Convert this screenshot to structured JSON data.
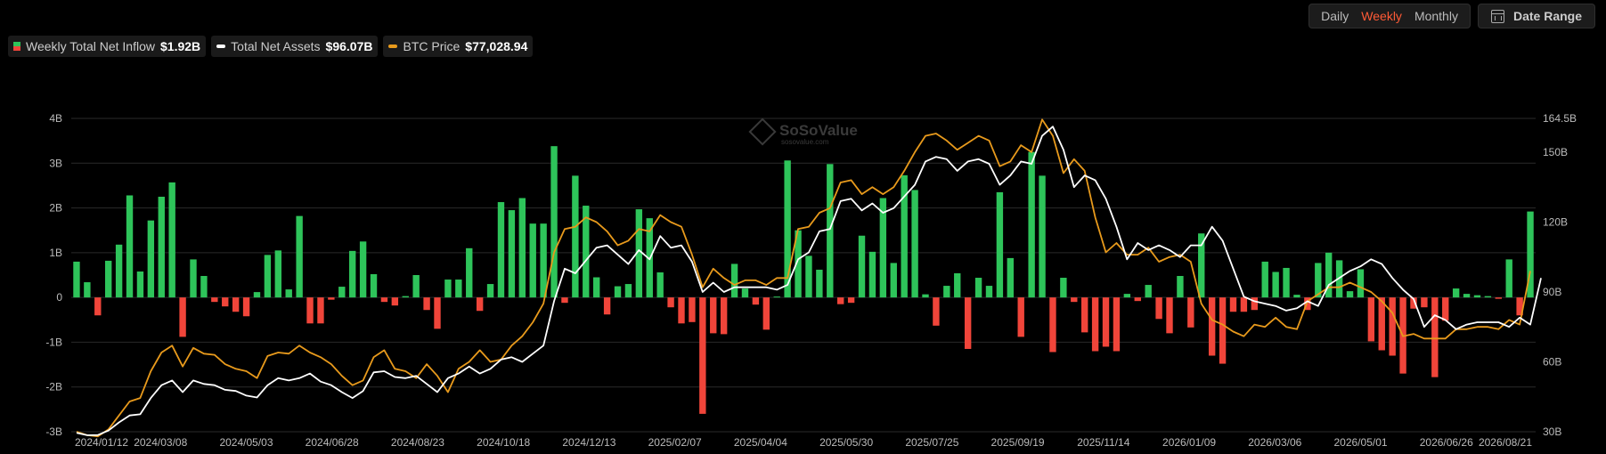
{
  "controls": {
    "daily": "Daily",
    "weekly": "Weekly",
    "monthly": "Monthly",
    "date_range": "Date Range"
  },
  "legend": {
    "inflow_label": "Weekly Total Net Inflow",
    "inflow_value": "$1.92B",
    "assets_label": "Total Net Assets",
    "assets_value": "$96.07B",
    "btc_label": "BTC Price",
    "btc_value": "$77,028.94"
  },
  "watermark": {
    "brand": "SoSoValue",
    "site": "sosovalue.com"
  },
  "colors": {
    "positive": "#2ec45a",
    "negative": "#f0453a",
    "assets_line": "#ffffff",
    "btc_line": "#e89a1c",
    "grid": "#2a2a2a"
  },
  "chart_data": {
    "type": "bar",
    "title": "",
    "xlabel": "",
    "ylabel": "",
    "ylim": [
      -3,
      4
    ],
    "y_ticks": [
      "-3B",
      "-2B",
      "-1B",
      "0",
      "1B",
      "2B",
      "3B",
      "4B"
    ],
    "y2lim": [
      30,
      164.5
    ],
    "y2_ticks": [
      "30B",
      "60B",
      "90B",
      "120B",
      "150B",
      "164.5B"
    ],
    "x_ticks": [
      "2024/01/12",
      "2024/03/08",
      "2024/05/03",
      "2024/06/28",
      "2024/08/23",
      "2024/10/18",
      "2024/12/13",
      "2025/02/07",
      "2025/04/04",
      "2025/05/30",
      "2025/07/25",
      "2025/09/19",
      "2025/11/14",
      "2026/01/09",
      "2026/03/06",
      "2026/05/01",
      "2026/06/26",
      "2026/08/21"
    ],
    "grid": true,
    "series": [
      {
        "name": "Weekly Total Net Inflow",
        "kind": "bar",
        "values": [
          0.8,
          0.34,
          -0.4,
          0.82,
          1.18,
          2.28,
          0.58,
          1.72,
          2.25,
          2.57,
          -0.88,
          0.85,
          0.48,
          -0.1,
          -0.2,
          -0.32,
          -0.42,
          0.12,
          0.95,
          1.05,
          0.18,
          1.82,
          -0.58,
          -0.58,
          -0.05,
          0.24,
          1.04,
          1.25,
          0.52,
          -0.1,
          -0.18,
          0.03,
          0.5,
          -0.28,
          -0.7,
          0.4,
          0.4,
          1.1,
          -0.3,
          0.3,
          2.13,
          1.95,
          2.22,
          1.65,
          1.65,
          3.38,
          -0.12,
          2.72,
          2.05,
          0.45,
          -0.38,
          0.25,
          0.3,
          1.97,
          1.77,
          0.56,
          -0.22,
          -0.58,
          -0.55,
          -2.6,
          -0.8,
          -0.82,
          0.75,
          0.2,
          -0.16,
          -0.72,
          0.02,
          3.06,
          1.5,
          0.93,
          0.62,
          2.98,
          -0.15,
          -0.12,
          1.38,
          1.02,
          2.22,
          0.77,
          2.73,
          2.4,
          0.07,
          -0.63,
          0.26,
          0.54,
          -1.15,
          0.44,
          0.26,
          2.35,
          0.88,
          -0.88,
          3.25,
          2.72,
          -1.22,
          0.44,
          -0.1,
          -0.78,
          -1.2,
          -1.1,
          -1.2,
          0.08,
          -0.08,
          0.28,
          -0.48,
          -0.8,
          0.48,
          -0.67,
          1.43,
          -1.3,
          -1.48,
          -0.32,
          -0.32,
          -0.28,
          0.8,
          0.57,
          0.66,
          0.06,
          -0.28,
          0.77,
          1.0,
          0.83,
          0.14,
          0.63,
          -0.98,
          -1.18,
          -1.3,
          -1.7,
          -0.25,
          -0.22,
          -1.78,
          -0.52,
          0.2,
          0.08,
          0.05,
          0.03,
          -0.03,
          0.85,
          -0.4,
          1.92
        ]
      },
      {
        "name": "Total Net Assets",
        "kind": "line",
        "values": [
          29.5,
          28.5,
          28.6,
          30.5,
          34,
          37,
          37.5,
          44.5,
          50,
          52,
          47,
          52,
          50.5,
          50,
          48,
          47.5,
          45.5,
          44.7,
          50,
          53,
          52,
          53,
          55,
          51.5,
          50,
          47,
          44.5,
          47.5,
          55.5,
          56,
          53.5,
          53,
          54,
          50.5,
          47,
          53,
          55,
          58,
          55,
          57,
          61,
          62,
          60,
          63.5,
          67,
          86,
          100,
          98,
          103.5,
          109,
          110,
          106,
          102,
          108,
          104,
          114,
          109,
          110,
          103,
          90,
          94,
          90,
          92,
          92,
          92,
          92,
          91,
          93,
          104,
          107,
          116,
          117,
          129,
          130,
          125,
          128,
          124,
          126,
          131,
          136,
          146,
          148,
          147,
          142,
          146,
          147,
          145,
          136,
          140,
          146,
          145,
          157,
          161,
          151,
          135,
          140,
          138,
          130,
          118,
          104,
          111,
          108,
          110,
          108,
          105,
          110,
          110,
          118,
          112,
          100,
          88,
          86,
          85,
          84,
          82,
          83,
          86,
          84,
          93,
          96,
          99,
          101,
          104,
          102,
          96,
          91,
          87,
          75,
          80,
          78,
          74,
          76,
          77,
          77,
          77,
          75,
          79,
          76,
          96
        ]
      },
      {
        "name": "BTC Price",
        "kind": "line",
        "values": [
          30,
          28.5,
          28,
          31,
          37,
          43,
          44.5,
          56,
          64,
          67,
          58,
          66,
          63.5,
          63,
          59,
          57,
          56,
          53,
          62.5,
          64,
          63.5,
          67,
          64,
          62,
          59,
          54,
          50,
          52,
          62,
          65,
          57,
          56,
          53,
          59,
          54,
          47,
          57,
          60,
          65,
          60,
          61,
          67,
          71,
          77,
          85,
          107,
          117,
          118,
          122,
          120,
          116,
          110,
          112,
          117,
          116,
          123,
          120,
          118,
          106,
          92,
          100,
          96,
          93,
          95,
          95,
          93,
          96,
          96,
          117,
          118,
          124,
          126,
          137,
          138,
          132,
          135,
          132,
          135,
          142,
          150,
          157,
          158,
          155,
          151,
          154,
          157,
          155,
          144,
          146,
          153,
          150,
          164,
          157,
          141,
          147,
          142,
          122,
          107,
          111,
          106,
          106,
          109,
          103,
          105,
          106,
          103,
          85,
          78,
          76,
          73,
          71,
          76,
          75,
          79,
          75,
          74,
          86,
          89,
          92,
          92,
          94,
          92,
          90,
          86,
          81,
          71,
          72,
          70,
          70,
          70,
          74,
          74,
          75,
          75,
          74,
          78,
          76,
          99
        ]
      }
    ]
  }
}
